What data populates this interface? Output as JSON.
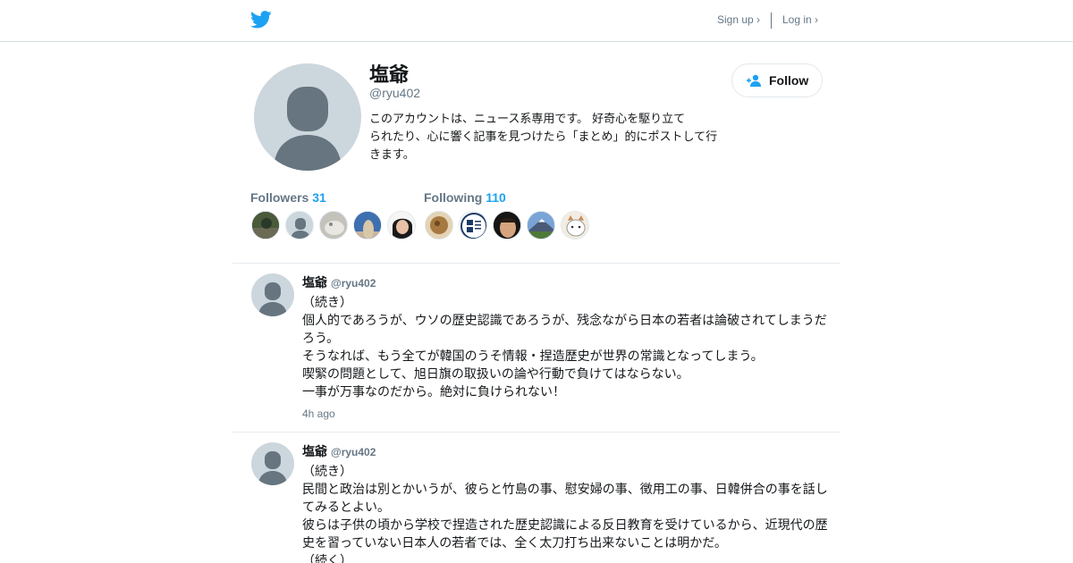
{
  "header": {
    "signup_label": "Sign up ›",
    "login_label": "Log in ›",
    "brand_color": "#1da1f2"
  },
  "profile": {
    "name": "塩爺",
    "handle": "@ryu402",
    "bio_lines": [
      "このアカウントは、ニュース系専用です。 好奇心を駆り立て",
      "られたり、心に響く記事を見つけたら「まとめ」的にポストして行",
      "きます。"
    ],
    "follow_label": "Follow",
    "followers_label": "Followers",
    "followers_count": "31",
    "following_label": "Following",
    "following_count": "110"
  },
  "tweets": [
    {
      "name": "塩爺",
      "handle": "@ryu402",
      "lines": [
        "（続き）",
        "個人的であろうが、ウソの歴史認識であろうが、残念ながら日本の若者は論破されてしまうだ",
        "ろう。",
        "そうなれば、もう全てが韓国のうそ情報・捏造歴史が世界の常識となってしまう。",
        "喫緊の問題として、旭日旗の取扱いの論や行動で負けてはならない。",
        "一事が万事なのだから。絶対に負けられない！"
      ],
      "time": "4h ago"
    },
    {
      "name": "塩爺",
      "handle": "@ryu402",
      "lines": [
        "（続き）",
        "民間と政治は別とかいうが、彼らと竹島の事、慰安婦の事、徴用工の事、日韓併合の事を話し",
        "てみるとよい。",
        "彼らは子供の頃から学校で捏造された歴史認識による反日教育を受けているから、近現代の歴",
        "史を習っていない日本人の若者では、全く太刀打ち出来ないことは明かだ。",
        "（続く）"
      ]
    }
  ]
}
